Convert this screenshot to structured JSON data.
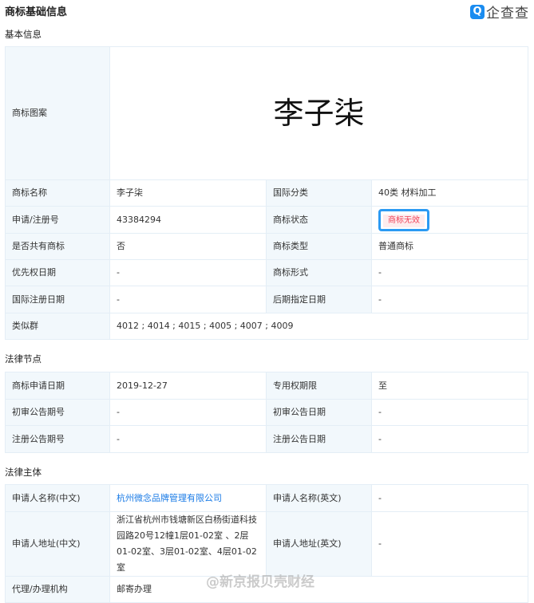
{
  "header": {
    "title": "商标基础信息",
    "logo": "企查查"
  },
  "basic": {
    "section": "基本信息",
    "image_label": "商标图案",
    "image_text": "李子柒",
    "rows": [
      [
        "商标名称",
        "李子柒",
        "国际分类",
        "40类 材料加工"
      ],
      [
        "申请/注册号",
        "43384294",
        "商标状态",
        "商标无效"
      ],
      [
        "是否共有商标",
        "否",
        "商标类型",
        "普通商标"
      ],
      [
        "优先权日期",
        "-",
        "商标形式",
        "-"
      ],
      [
        "国际注册日期",
        "-",
        "后期指定日期",
        "-"
      ]
    ],
    "similar_label": "类似群",
    "similar_value": "4012 ; 4014 ; 4015 ; 4005 ; 4007 ; 4009"
  },
  "legal_nodes": {
    "section": "法律节点",
    "rows": [
      [
        "商标申请日期",
        "2019-12-27",
        "专用权期限",
        "至"
      ],
      [
        "初审公告期号",
        "-",
        "初审公告日期",
        "-"
      ],
      [
        "注册公告期号",
        "-",
        "注册公告日期",
        "-"
      ]
    ]
  },
  "legal_subject": {
    "section": "法律主体",
    "name_cn_label": "申请人名称(中文)",
    "name_cn": "杭州微念品牌管理有限公司",
    "name_en_label": "申请人名称(英文)",
    "name_en": "-",
    "addr_cn_label": "申请人地址(中文)",
    "addr_cn": "浙江省杭州市钱塘新区白杨街道科技园路20号12幢1层01-02室 、2层01-02室、3层01-02室、4层01-02室",
    "addr_en_label": "申请人地址(英文)",
    "addr_en": "-",
    "agent_label": "代理/办理机构",
    "agent": "邮寄办理"
  },
  "watermark": "@新京报贝壳财经"
}
